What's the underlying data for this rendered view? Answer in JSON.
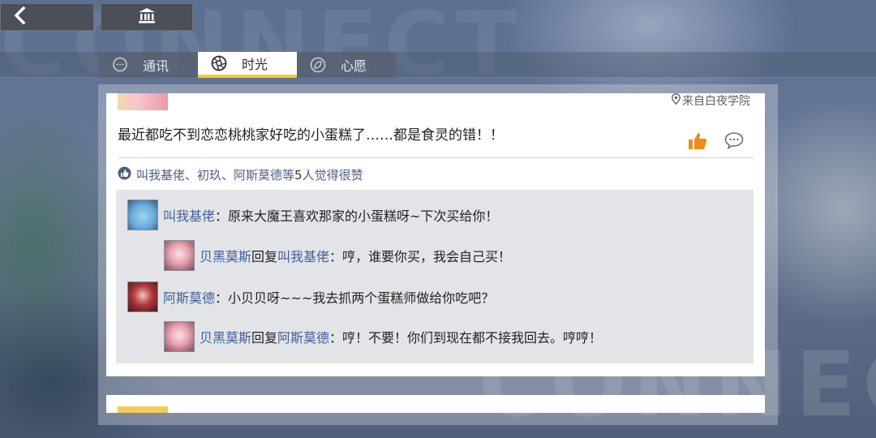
{
  "background": {
    "watermark": "CONNECT"
  },
  "top_buttons": {
    "back_icon": "chevron-left-icon",
    "home_icon": "museum-icon"
  },
  "tabs": [
    {
      "label": "通讯",
      "icon": "chat-bubble-icon",
      "active": false
    },
    {
      "label": "时光",
      "icon": "aperture-icon",
      "active": true
    },
    {
      "label": "心愿",
      "icon": "wish-icon",
      "active": false
    }
  ],
  "post": {
    "location": "来自白夜学院",
    "text": "最近都吃不到恋恋桃桃家好吃的小蛋糕了……都是食灵的错！！",
    "likes_names": "叫我基佬、初玖、阿斯莫德等",
    "likes_count": "5",
    "likes_suffix": "人觉得很赞"
  },
  "comments": [
    {
      "name": "叫我基佬",
      "text": "：原来大魔王喜欢那家的小蛋糕呀~下次买给你！"
    },
    {
      "name": "贝黑莫斯",
      "reply_word": "回复",
      "reply_to": "叫我基佬",
      "text": "：哼，谁要你买，我会自己买！"
    },
    {
      "name": "阿斯莫德",
      "text": "：小贝贝呀~~~我去抓两个蛋糕师做给你吃吧？"
    },
    {
      "name": "贝黑莫斯",
      "reply_word": "回复",
      "reply_to": "阿斯莫德",
      "text": "：哼！不要！你们到现在都不接我回去。哼哼！"
    }
  ],
  "colors": {
    "accent": "#f2cc2c",
    "name_link": "#3f5f9c",
    "like_orange": "#f08a1c"
  }
}
